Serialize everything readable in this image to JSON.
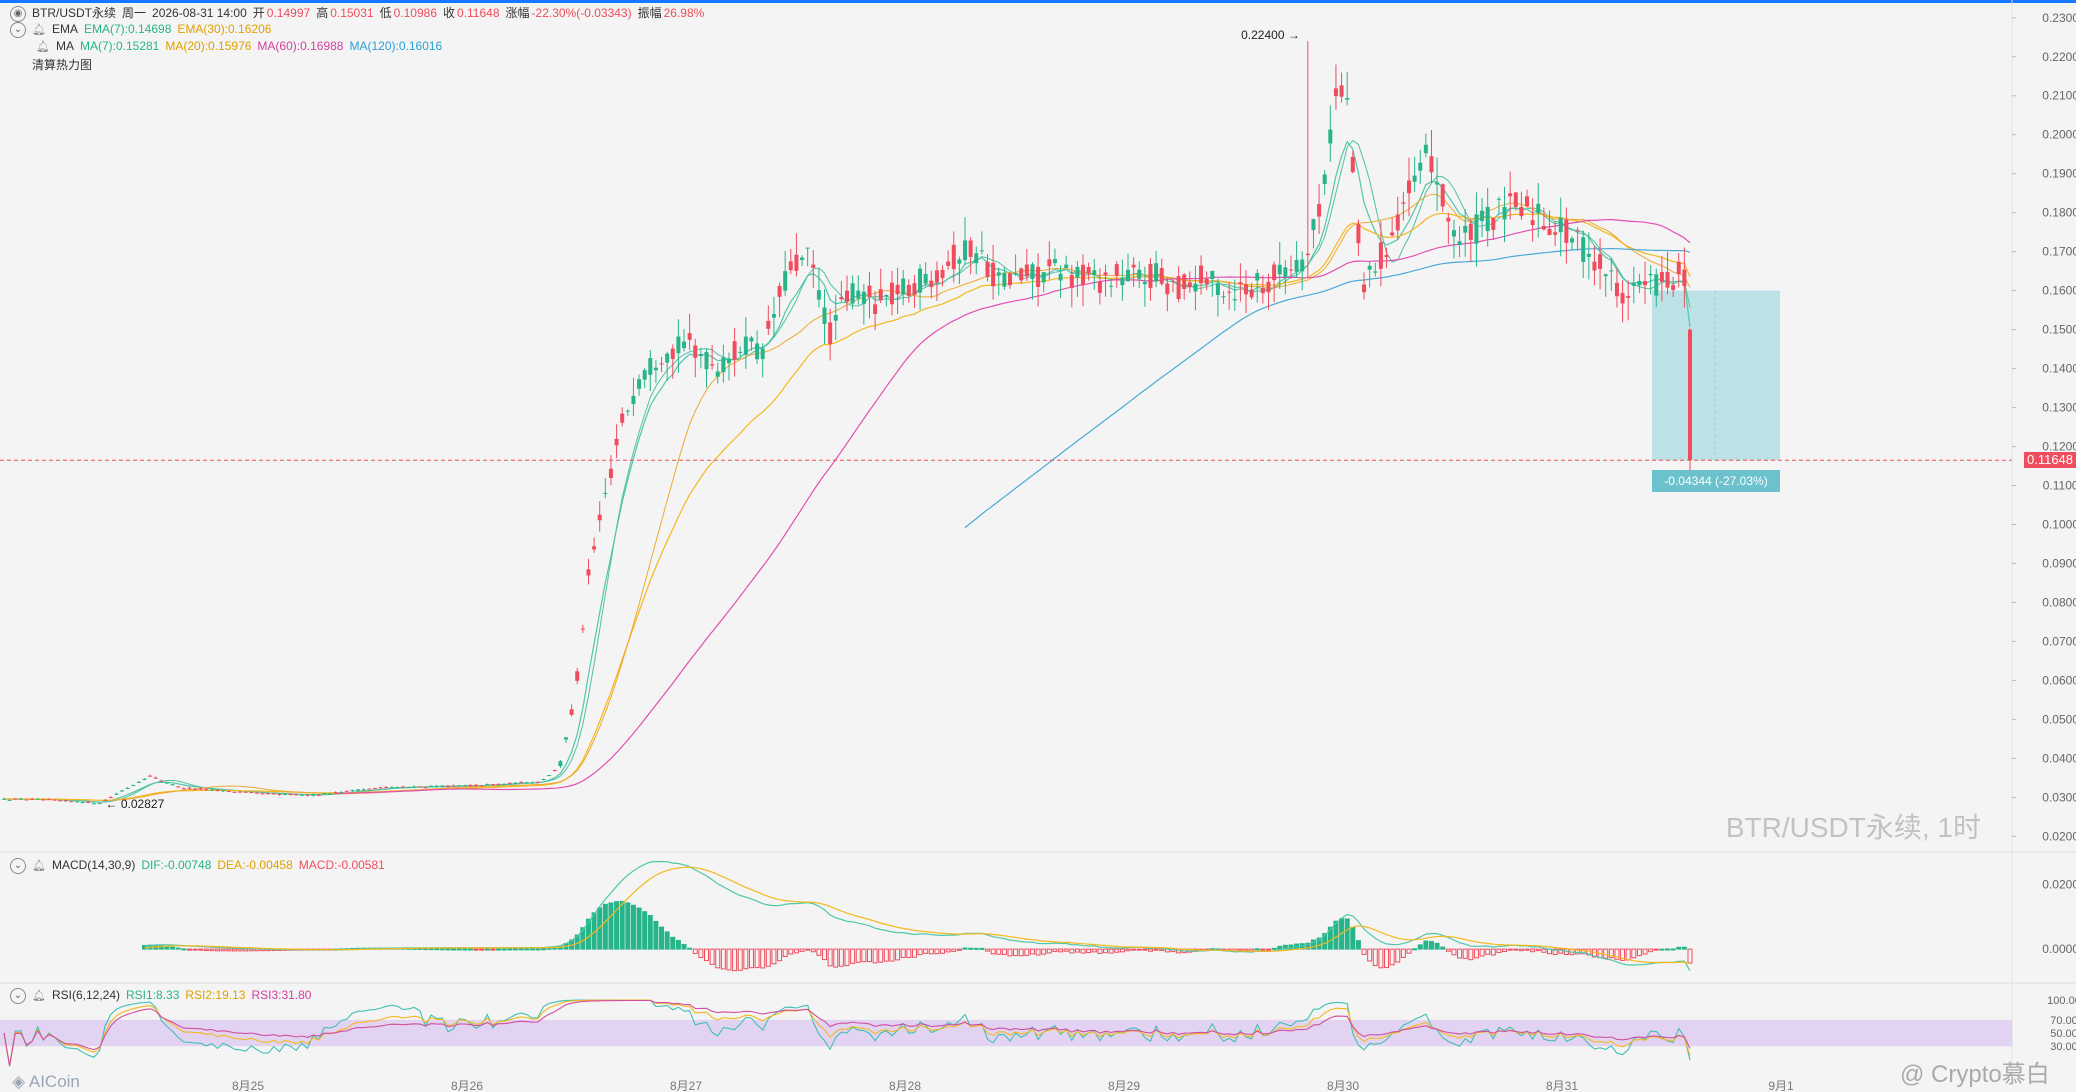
{
  "colors": {
    "up": "#27b489",
    "down": "#ef4d5d",
    "ema7": "#4fc7a9",
    "ema30": "#f5b81d",
    "ma60": "#e34eb3",
    "ma120": "#4aa9d8",
    "macd_dif": "#4fc7a9",
    "macd_dea": "#f5b81d",
    "rsi1": "#3fc0b5",
    "rsi2": "#f5b81d",
    "rsi3": "#d14ea0",
    "accent": "#1677ff",
    "measure": "#8fd3d9"
  },
  "header": {
    "symbol": "BTR/USDT永续",
    "weekday": "周一",
    "datetime": "2026-08-31 14:00",
    "open_label": "开",
    "open": "0.14997",
    "high_label": "高",
    "high": "0.15031",
    "low_label": "低",
    "low": "0.10986",
    "close_label": "收",
    "close": "0.11648",
    "change_label": "涨幅",
    "change": "-22.30%(-0.03343)",
    "amplitude_label": "振幅",
    "amplitude": "26.98%"
  },
  "indicators": {
    "ema": {
      "name": "EMA",
      "ema7": "EMA(7):0.14698",
      "ema30": "EMA(30):0.16206"
    },
    "ma": {
      "name": "MA",
      "ma7": "MA(7):0.15281",
      "ma20": "MA(20):0.15976",
      "ma60": "MA(60):0.16988",
      "ma120": "MA(120):0.16016"
    },
    "heatmap": "清算热力图",
    "macd": {
      "name": "MACD(14,30,9)",
      "dif": "DIF:-0.00748",
      "dea": "DEA:-0.00458",
      "macd": "MACD:-0.00581"
    },
    "rsi": {
      "name": "RSI(6,12,24)",
      "rsi1": "RSI1:8.33",
      "rsi2": "RSI2:19.13",
      "rsi3": "RSI3:31.80"
    }
  },
  "chart_data": [
    {
      "type": "candlestick",
      "title": "BTR/USDT永续, 1时",
      "x_labels": [
        "8月25",
        "8月26",
        "8月27",
        "8月28",
        "8月29",
        "8月30",
        "8月31",
        "9月1"
      ],
      "y_ticks": [
        "0.23000",
        "0.22000",
        "0.21000",
        "0.20000",
        "0.19000",
        "0.18000",
        "0.17000",
        "0.16000",
        "0.15000",
        "0.14000",
        "0.13000",
        "0.12000",
        "0.11000",
        "0.10000",
        "0.09000",
        "0.08000",
        "0.07000",
        "0.06000",
        "0.05000",
        "0.04000",
        "0.03000",
        "0.02000"
      ],
      "y_range": [
        0.017,
        0.232
      ],
      "current_price": "0.11648",
      "max_label": "0.22400",
      "min_label": "0.02827",
      "measure_label": "-0.04344 (-27.03%)",
      "last_bar": {
        "open": 0.14997,
        "high": 0.15031,
        "low": 0.10986,
        "close": 0.11648
      }
    },
    {
      "type": "bar",
      "title": "MACD(14,30,9)",
      "y_ticks": [
        "0.02000",
        "0.00000"
      ],
      "y_range": [
        -0.008,
        0.026
      ]
    },
    {
      "type": "line",
      "title": "RSI(6,12,24)",
      "y_ticks": [
        "100.00",
        "70.00",
        "50.00",
        "30.00"
      ],
      "y_range": [
        0,
        100
      ]
    }
  ],
  "watermark": "BTR/USDT永续, 1时",
  "logo": "AICoin",
  "credit": "@ Crypto慕白"
}
